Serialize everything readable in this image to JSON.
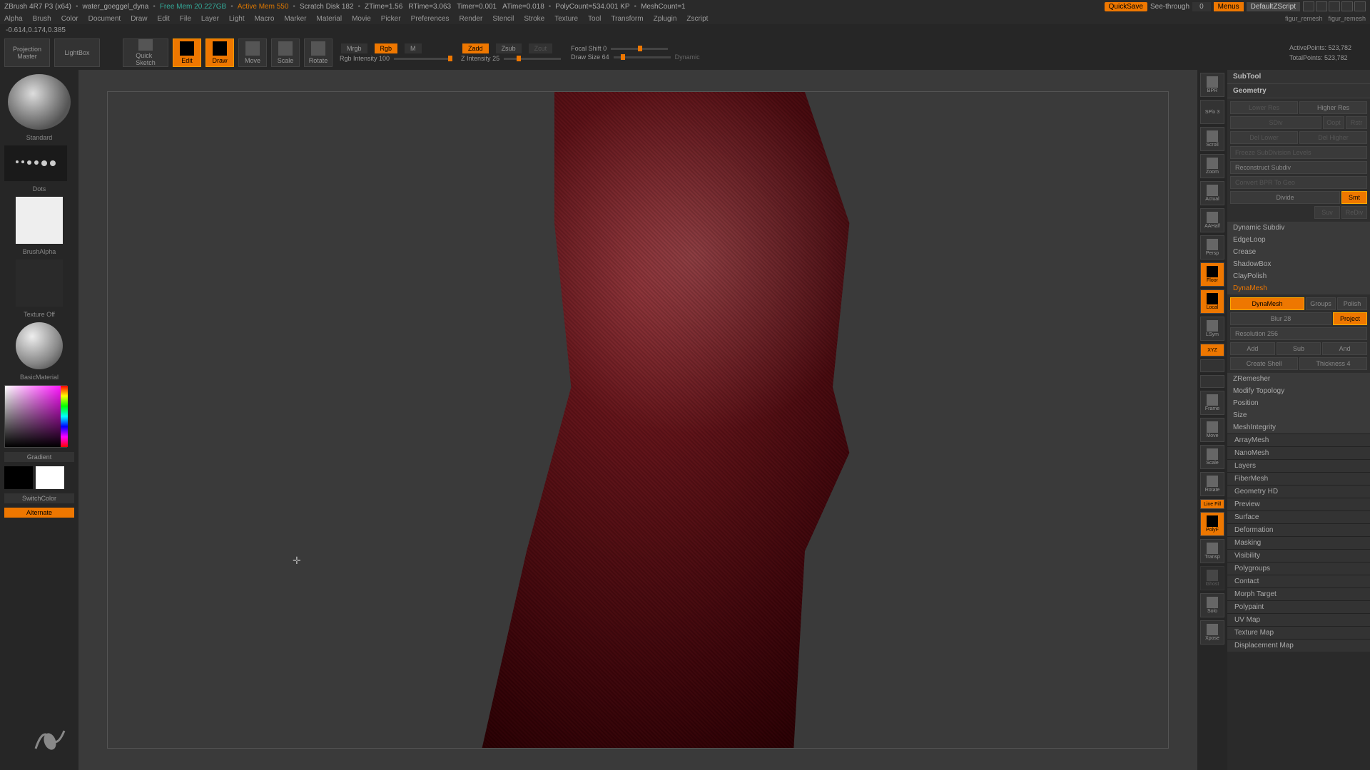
{
  "titlebar": {
    "app": "ZBrush 4R7 P3 (x64)",
    "file": "water_goeggel_dyna",
    "free_mem": "Free Mem 20.227GB",
    "active_mem": "Active Mem 550",
    "scratch": "Scratch Disk 182",
    "ztime": "ZTime=1.56",
    "rtime": "RTime=3.063",
    "timer": "Timer=0.001",
    "atime": "ATime=0.018",
    "polycount": "PolyCount=534.001 KP",
    "meshcount": "MeshCount=1",
    "quicksave": "QuickSave",
    "seethrough": "See-through",
    "seethrough_val": "0",
    "menus": "Menus",
    "default_zscript": "DefaultZScript"
  },
  "menu": [
    "Alpha",
    "Brush",
    "Color",
    "Document",
    "Draw",
    "Edit",
    "File",
    "Layer",
    "Light",
    "Macro",
    "Marker",
    "Material",
    "Movie",
    "Picker",
    "Preferences",
    "Render",
    "Stencil",
    "Stroke",
    "Texture",
    "Tool",
    "Transform",
    "Zplugin",
    "Zscript"
  ],
  "breadcrumb": [
    "figur_remesh",
    "figur_remesh"
  ],
  "coord": "-0.614,0.174,0.385",
  "toolbar": {
    "projection": "Projection\nMaster",
    "lightbox": "LightBox",
    "quicksketch": "Quick\nSketch",
    "edit": "Edit",
    "draw": "Draw",
    "move": "Move",
    "scale": "Scale",
    "rotate": "Rotate",
    "mrgb": "Mrgb",
    "rgb": "Rgb",
    "m": "M",
    "rgb_intensity": "Rgb Intensity 100",
    "zadd": "Zadd",
    "zsub": "Zsub",
    "zcut": "Zcut",
    "z_intensity": "Z Intensity 25",
    "focal": "Focal Shift 0",
    "draw_size": "Draw Size 64",
    "dynamic": "Dynamic",
    "active_points": "ActivePoints: 523,782",
    "total_points": "TotalPoints: 523,782"
  },
  "left": {
    "brush": "Standard",
    "stroke": "Dots",
    "alpha": "BrushAlpha",
    "texture": "Texture Off",
    "material": "BasicMaterial",
    "gradient": "Gradient",
    "switch": "SwitchColor",
    "alternate": "Alternate"
  },
  "right_icons": [
    "BPR",
    "SPix 3",
    "Scroll",
    "Zoom",
    "Actual",
    "AAHalf",
    "Persp",
    "Floor",
    "Local",
    "LSym",
    "XYZ",
    "",
    "",
    "Frame",
    "Move",
    "Scale",
    "Rotate",
    "Line Fill",
    "PolyF",
    "Transp",
    "Ghost",
    "Solo",
    "Xpose"
  ],
  "right_panel": {
    "subtool": "SubTool",
    "geometry": "Geometry",
    "lower_res": "Lower Res",
    "higher_res": "Higher Res",
    "sdiv": "SDiv",
    "opt": "Oopt",
    "rstr": "Rstr",
    "del_lower": "Del Lower",
    "del_higher": "Del Higher",
    "freeze": "Freeze SubDivision Levels",
    "reconstruct": "Reconstruct Subdiv",
    "convert": "Convert BPR To Geo",
    "divide": "Divide",
    "smt": "Smt",
    "suv": "Suv",
    "rediv": "ReDiv",
    "dynamic_subdiv": "Dynamic Subdiv",
    "edgeloop": "EdgeLoop",
    "crease": "Crease",
    "shadowbox": "ShadowBox",
    "claypolish": "ClayPolish",
    "dynamesh_hdr": "DynaMesh",
    "dynamesh": "DynaMesh",
    "groups": "Groups",
    "polish": "Polish",
    "blur": "Blur 28",
    "project": "Project",
    "resolution": "Resolution 256",
    "add": "Add",
    "sub": "Sub",
    "and": "And",
    "create_shell": "Create Shell",
    "thickness": "Thickness 4",
    "zremesher": "ZRemesher",
    "modify_topology": "Modify Topology",
    "position": "Position",
    "size": "Size",
    "meshintegrity": "MeshIntegrity",
    "sections": [
      "ArrayMesh",
      "NanoMesh",
      "Layers",
      "FiberMesh",
      "Geometry HD",
      "Preview",
      "Surface",
      "Deformation",
      "Masking",
      "Visibility",
      "Polygroups",
      "Contact",
      "Morph Target",
      "Polypaint",
      "UV Map",
      "Texture Map",
      "Displacement Map"
    ]
  }
}
